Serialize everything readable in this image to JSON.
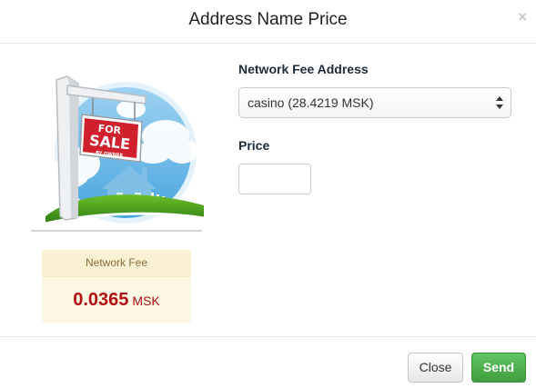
{
  "modal": {
    "title": "Address Name Price",
    "close_glyph": "×"
  },
  "illustration": {
    "sign_line1": "FOR",
    "sign_line2": "SALE",
    "sign_line3": "BY OWNER",
    "icon": "for-sale-sign-illustration"
  },
  "fee_panel": {
    "heading": "Network Fee",
    "value": "0.0365",
    "unit": "MSK"
  },
  "form": {
    "fee_address_label": "Network Fee Address",
    "fee_address_selected": "casino (28.4219 MSK)",
    "price_label": "Price",
    "price_value": ""
  },
  "footer": {
    "close_label": "Close",
    "send_label": "Send"
  },
  "colors": {
    "fee_value": "#b20d12",
    "send_button": "#5cb85c",
    "sign_red": "#d0202e"
  }
}
